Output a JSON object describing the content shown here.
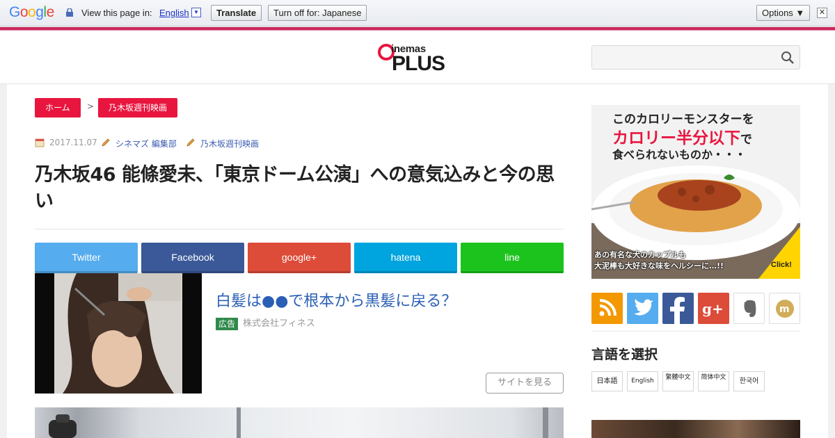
{
  "translate_bar": {
    "logo": "Google",
    "prompt": "View this page in:",
    "language": "English",
    "language_dropdown": "▼",
    "translate_button": "Translate",
    "turn_off_button": "Turn off for: Japanese",
    "options_button": "Options ▼",
    "close": "✕"
  },
  "header": {
    "logo_top": "inemas",
    "logo_bottom": "PLUS",
    "search_placeholder": ""
  },
  "breadcrumb": {
    "items": [
      "ホーム",
      "乃木坂週刊映画"
    ],
    "separator": ">"
  },
  "article": {
    "date": "2017.11.07",
    "author": "シネマズ 編集部",
    "category": "乃木坂週刊映画",
    "title": "乃木坂46 能條愛未、「東京ドーム公演」への意気込みと今の思い"
  },
  "share": {
    "buttons": [
      {
        "label": "Twitter",
        "color": "#55acee"
      },
      {
        "label": "Facebook",
        "color": "#3b5998"
      },
      {
        "label": "google+",
        "color": "#dd4b39"
      },
      {
        "label": "hatena",
        "color": "#00a4de"
      },
      {
        "label": "line",
        "color": "#1dc31d"
      }
    ]
  },
  "ad": {
    "headline": "白髪は●●で根本から黒髪に戻る？",
    "badge": "広告",
    "source": "株式会社フィネス",
    "button": "サイトを見る"
  },
  "sidebar": {
    "banner": {
      "line1": "このカロリーモンスターを",
      "line2": "カロリー半分以下",
      "line2_suffix": "で",
      "line3": "食べられないものか・・・",
      "line4a": "あの有名な犬のカップルも",
      "line4b": "大泥棒も大好きな味をヘルシーに…!!",
      "click": "Click!"
    },
    "social_icons": [
      {
        "name": "rss-icon",
        "color": "#f39800"
      },
      {
        "name": "twitter-icon",
        "color": "#55acee"
      },
      {
        "name": "facebook-icon",
        "color": "#3b5998"
      },
      {
        "name": "google-plus-icon",
        "color": "#dd4b39"
      },
      {
        "name": "evernote-icon",
        "color": "#ffffff"
      },
      {
        "name": "mixi-icon",
        "color": "#ffffff"
      }
    ],
    "language_title": "言語を選択",
    "languages": [
      "日本語",
      "English",
      "繁體中文",
      "简体中文",
      "한국어"
    ]
  }
}
